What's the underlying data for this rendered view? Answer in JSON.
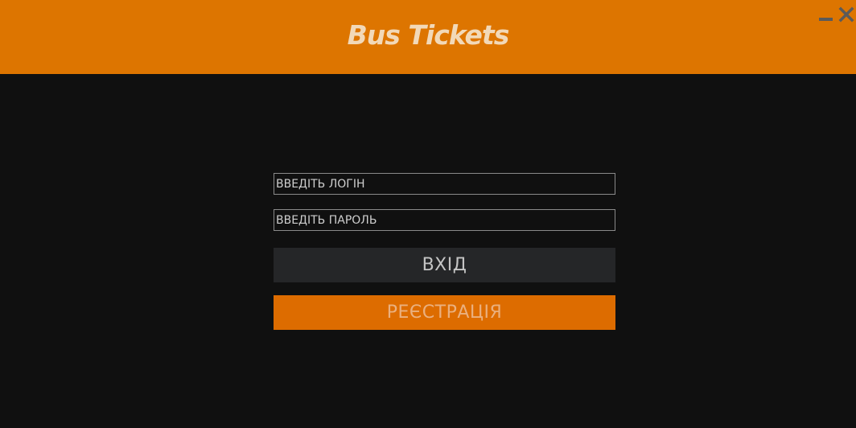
{
  "app": {
    "title": "Bus Tickets"
  },
  "window_controls": {
    "minimize_icon": "minimize-icon",
    "close_icon": "close-icon"
  },
  "login_form": {
    "login_placeholder": "ВВЕДІТЬ ЛОГІН",
    "password_placeholder": "ВВЕДІТЬ ПАРОЛЬ",
    "login_value": "",
    "password_value": "",
    "enter_label": "ВХІД",
    "register_label": "РЕЄСТРАЦІЯ"
  },
  "colors": {
    "accent": "#dd7500",
    "background": "#101010",
    "enter_button": "#252628",
    "register_button": "#dd6c00"
  }
}
